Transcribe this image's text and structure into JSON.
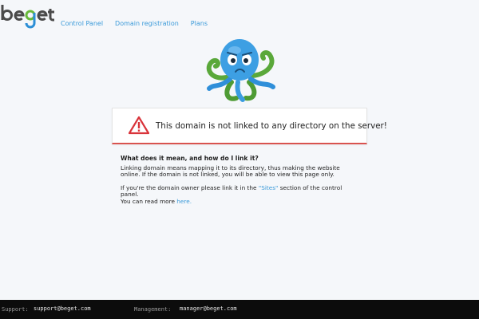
{
  "brand": {
    "logo_letters": [
      "b",
      "e",
      "g",
      "e",
      "t"
    ],
    "colors": {
      "dark": "#4a4a4a",
      "g_green": "#67b93a",
      "g_blue": "#2c8fd6"
    }
  },
  "nav": {
    "items": [
      "Control Panel",
      "Domain registration",
      "Plans"
    ]
  },
  "alert": {
    "message": "This domain is not linked to any directory on the server!",
    "icon": "warning-triangle-icon",
    "accent": "#d9534f"
  },
  "info": {
    "question": "What does it mean, and how do I link it?",
    "explanation": "Linking domain means mapping it to its directory, thus making the website online. If the domain is not linked, you will be able to view this page only.",
    "owner_before": "If you're the domain owner please link it in the ",
    "owner_link": "\"Sites\"",
    "owner_after": " section of the control panel.",
    "more_before": "You can read more ",
    "more_link": "here."
  },
  "footer": {
    "support_label": "Support:",
    "support_email": "support@beget.com",
    "manager_label": "Management:",
    "manager_email": "manager@beget.com"
  },
  "colors": {
    "link": "#3a9ad9",
    "background": "#f5f7fa",
    "footer_bg": "#0c0c0c"
  }
}
